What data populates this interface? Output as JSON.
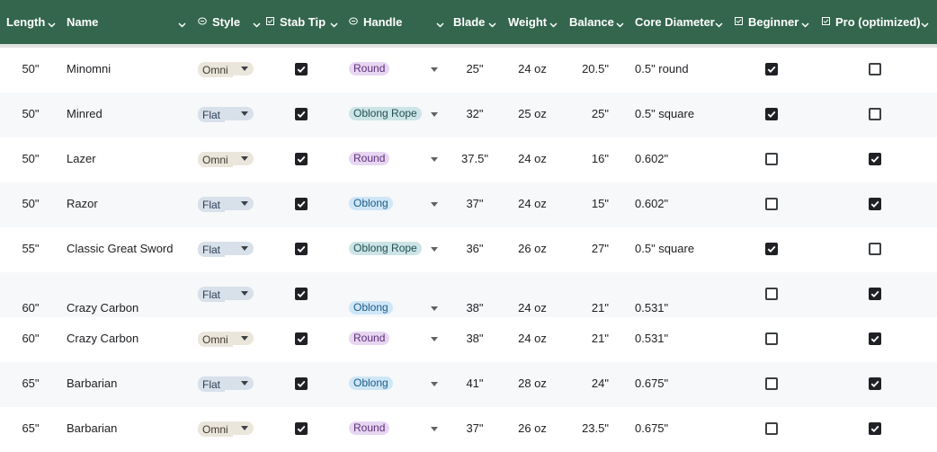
{
  "columns": [
    {
      "label": "Length",
      "icon": null
    },
    {
      "label": "Name",
      "icon": null
    },
    {
      "label": "Style",
      "icon": "single-select-icon"
    },
    {
      "label": "Stab Tip",
      "icon": "checkbox-icon"
    },
    {
      "label": "Handle",
      "icon": "single-select-icon"
    },
    {
      "label": "Blade",
      "icon": null
    },
    {
      "label": "Weight",
      "icon": null
    },
    {
      "label": "Balance",
      "icon": null
    },
    {
      "label": "Core Diameter",
      "icon": null
    },
    {
      "label": "Beginner",
      "icon": "checkbox-icon"
    },
    {
      "label": "Pro (optimized)",
      "icon": "checkbox-icon"
    }
  ],
  "colors": {
    "header_bg": "#33664d",
    "header_text": "#ffffff",
    "row_alt_bg": "#f6f8fa"
  },
  "rows": [
    {
      "length": "50\"",
      "name": "Minomni",
      "style": "Omni",
      "stab_tip": true,
      "handle": "Round",
      "blade": "25\"",
      "weight": "24 oz",
      "balance": "20.5\"",
      "core_diameter": "0.5\" round",
      "beginner": true,
      "pro": false
    },
    {
      "length": "50\"",
      "name": "Minred",
      "style": "Flat",
      "stab_tip": true,
      "handle": "Oblong Rope",
      "blade": "32\"",
      "weight": "25 oz",
      "balance": "25\"",
      "core_diameter": "0.5\" square",
      "beginner": true,
      "pro": false
    },
    {
      "length": "50\"",
      "name": "Lazer",
      "style": "Omni",
      "stab_tip": true,
      "handle": "Round",
      "blade": "37.5\"",
      "weight": "24 oz",
      "balance": "16\"",
      "core_diameter": "0.602\"",
      "beginner": false,
      "pro": true
    },
    {
      "length": "50\"",
      "name": "Razor",
      "style": "Flat",
      "stab_tip": true,
      "handle": "Oblong",
      "blade": "37\"",
      "weight": "24 oz",
      "balance": "15\"",
      "core_diameter": "0.602\"",
      "beginner": false,
      "pro": true
    },
    {
      "length": "55\"",
      "name": "Classic Great Sword",
      "style": "Flat",
      "stab_tip": true,
      "handle": "Oblong Rope",
      "blade": "36\"",
      "weight": "26 oz",
      "balance": "27\"",
      "core_diameter": "0.5\" square",
      "beginner": true,
      "pro": false
    },
    {
      "length": "60\"",
      "name": "Crazy Carbon",
      "style": "Flat",
      "stab_tip": true,
      "handle": "Oblong",
      "blade": "38\"",
      "weight": "24 oz",
      "balance": "21\"",
      "core_diameter": "0.531\"",
      "beginner": false,
      "pro": true
    },
    {
      "length": "60\"",
      "name": "Crazy Carbon",
      "style": "Omni",
      "stab_tip": true,
      "handle": "Round",
      "blade": "38\"",
      "weight": "24 oz",
      "balance": "21\"",
      "core_diameter": "0.531\"",
      "beginner": false,
      "pro": true
    },
    {
      "length": "65\"",
      "name": "Barbarian",
      "style": "Flat",
      "stab_tip": true,
      "handle": "Oblong",
      "blade": "41\"",
      "weight": "28 oz",
      "balance": "24\"",
      "core_diameter": "0.675\"",
      "beginner": false,
      "pro": true
    },
    {
      "length": "65\"",
      "name": "Barbarian",
      "style": "Omni",
      "stab_tip": true,
      "handle": "Round",
      "blade": "37\"",
      "weight": "26 oz",
      "balance": "23.5\"",
      "core_diameter": "0.675\"",
      "beginner": false,
      "pro": true
    }
  ]
}
